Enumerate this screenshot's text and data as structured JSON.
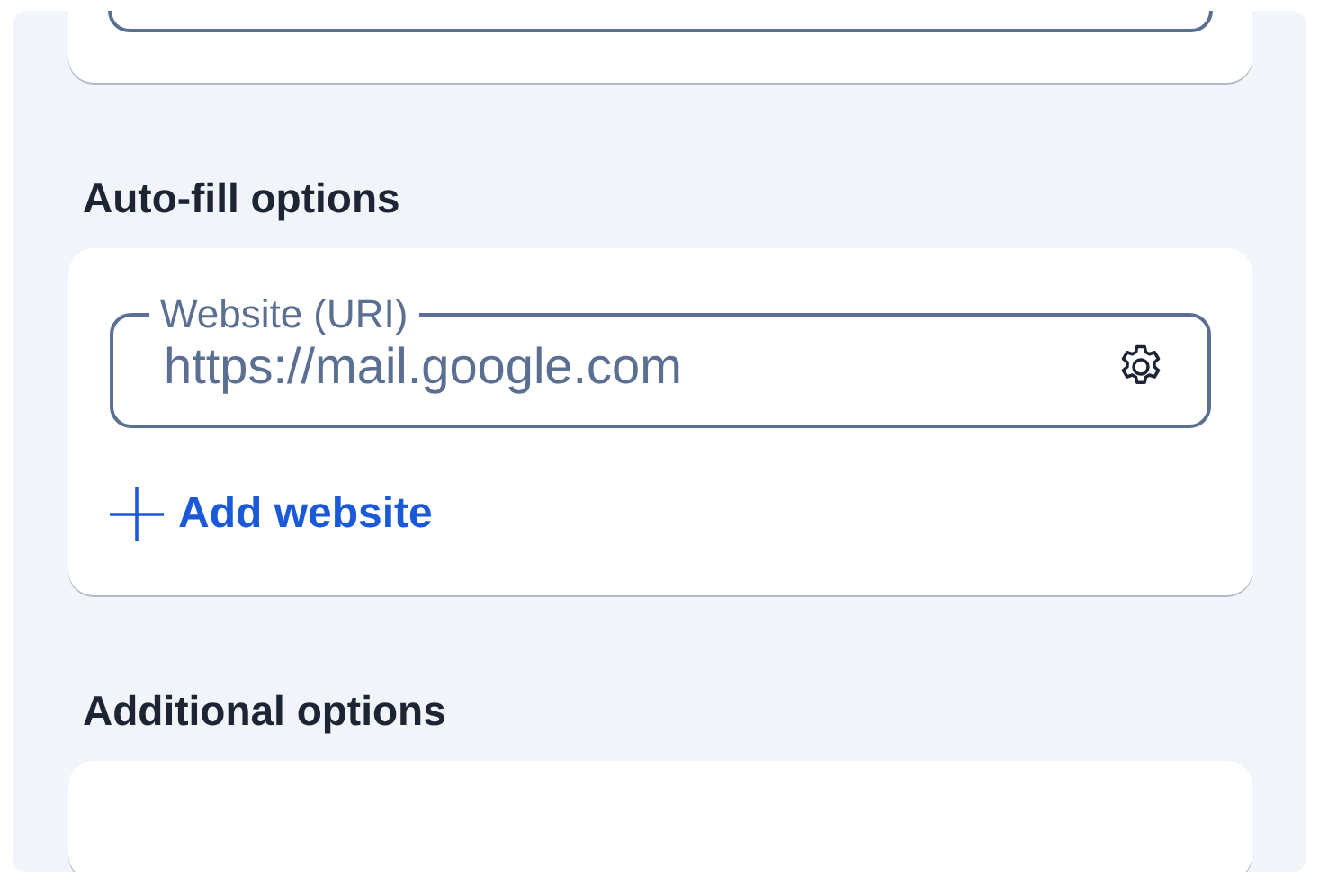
{
  "sections": [
    {
      "heading": "Auto-fill options",
      "fields": [
        {
          "label": "Website (URI)",
          "value": "https://mail.google.com"
        }
      ],
      "add_button": "Add website"
    },
    {
      "heading": "Additional options"
    }
  ]
}
